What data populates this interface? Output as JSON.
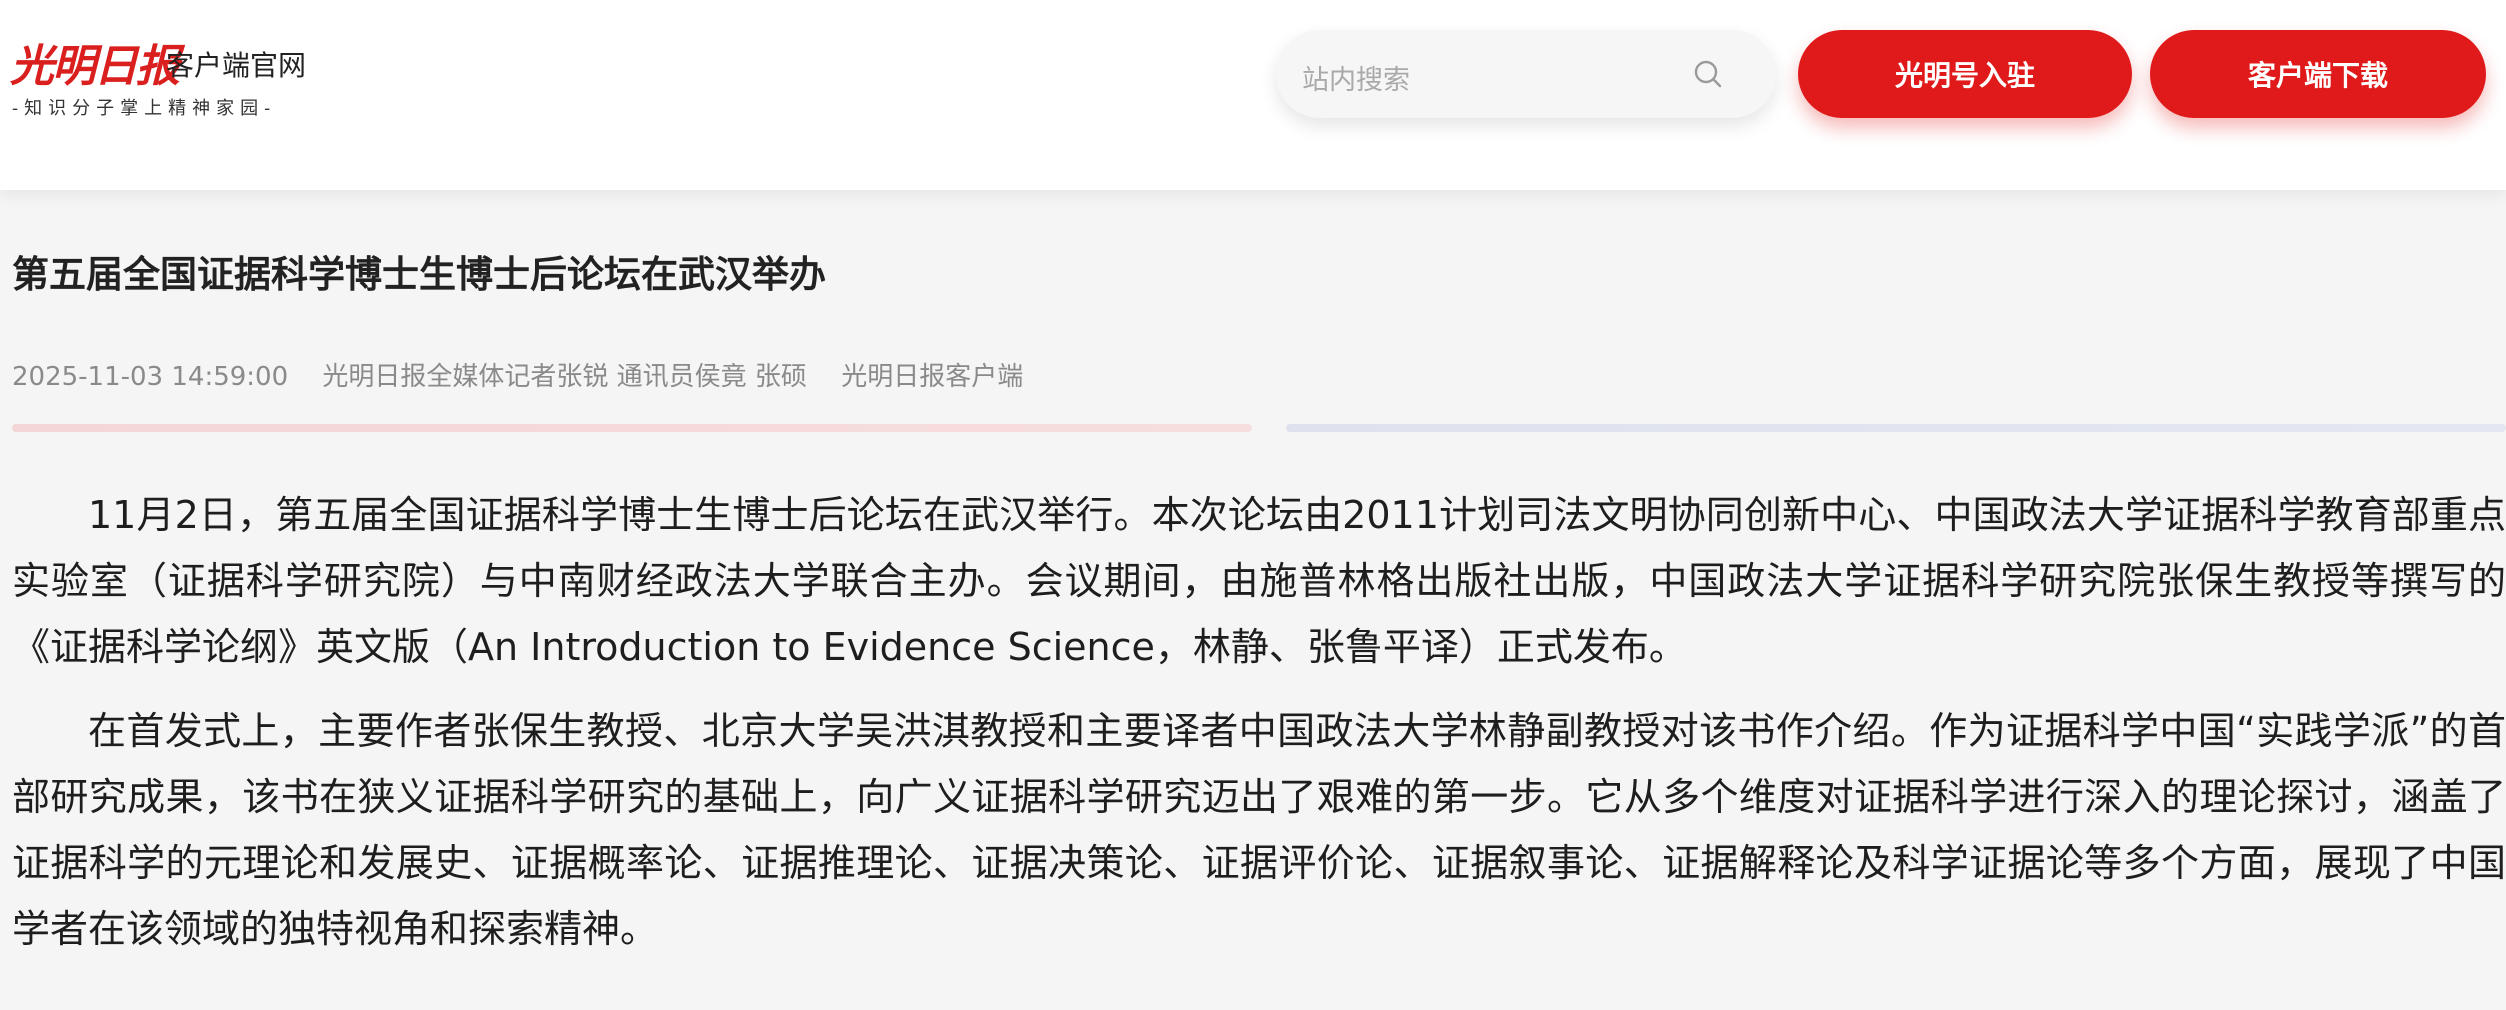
{
  "header": {
    "logo_calligraphy": "光明日报",
    "logo_subtitle": "客户端官网",
    "logo_slogan": "-知识分子掌上精神家园-",
    "search_placeholder": "站内搜索",
    "join_button": "光明号入驻",
    "download_button": "客户端下载",
    "colors": {
      "brand_red": "#e01a1a",
      "page_bg": "#f5f5f5"
    }
  },
  "article": {
    "title": "第五届全国证据科学博士生博士后论坛在武汉举办",
    "datetime": "2025-11-03 14:59:00",
    "author": "光明日报全媒体记者张锐 通讯员侯竟 张硕",
    "source": "光明日报客户端",
    "paragraphs": [
      "11月2日，第五届全国证据科学博士生博士后论坛在武汉举行。本次论坛由2011计划司法文明协同创新中心、中国政法大学证据科学教育部重点实验室（证据科学研究院）与中南财经政法大学联合主办。会议期间，由施普林格出版社出版，中国政法大学证据科学研究院张保生教授等撰写的《证据科学论纲》英文版（An Introduction to Evidence Science，林静、张鲁平译）正式发布。",
      "在首发式上，主要作者张保生教授、北京大学吴洪淇教授和主要译者中国政法大学林静副教授对该书作介绍。作为证据科学中国“实践学派”的首部研究成果，该书在狭义证据科学研究的基础上，向广义证据科学研究迈出了艰难的第一步。它从多个维度对证据科学进行深入的理论探讨，涵盖了证据科学的元理论和发展史、证据概率论、证据推理论、证据决策论、证据评价论、证据叙事论、证据解释论及科学证据论等多个方面，展现了中国学者在该领域的独特视角和探索精神。"
    ]
  }
}
